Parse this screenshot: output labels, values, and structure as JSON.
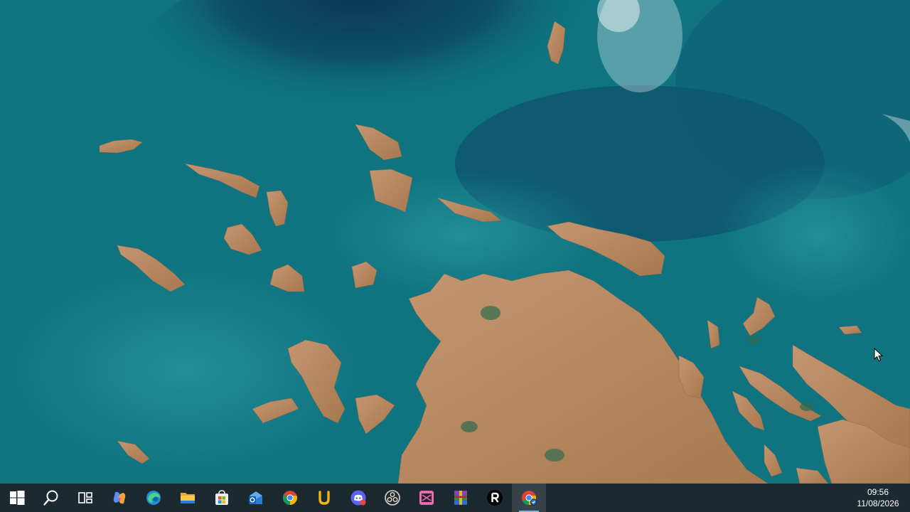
{
  "taskbar": {
    "apps": [
      {
        "name": "Start",
        "icon": "windows-logo-icon"
      },
      {
        "name": "Search",
        "icon": "search-icon"
      },
      {
        "name": "Task View",
        "icon": "task-view-icon"
      },
      {
        "name": "Copilot",
        "icon": "copilot-icon"
      },
      {
        "name": "Microsoft Edge",
        "icon": "edge-icon"
      },
      {
        "name": "File Explorer",
        "icon": "folder-icon"
      },
      {
        "name": "Microsoft Store",
        "icon": "store-icon"
      },
      {
        "name": "Outlook",
        "icon": "outlook-icon"
      },
      {
        "name": "Google Chrome",
        "icon": "chrome-icon"
      },
      {
        "name": "U app",
        "icon": "u-app-icon"
      },
      {
        "name": "Discord",
        "icon": "discord-icon"
      },
      {
        "name": "OBS",
        "icon": "obs-icon"
      },
      {
        "name": "Film app",
        "icon": "film-app-icon"
      },
      {
        "name": "WinRAR",
        "icon": "winrar-icon"
      },
      {
        "name": "R app",
        "icon": "r-app-icon"
      },
      {
        "name": "Chrome Canary",
        "icon": "chrome-canary-icon"
      }
    ],
    "accent": "#76b9ed"
  },
  "tray": {
    "time": "09:56",
    "date": "11/08/2026"
  },
  "colors": {
    "sea": "#0e6f7a",
    "deep_sea": "#0b3d5a",
    "land": "#b88a64",
    "taskbar": "#1c2a30"
  }
}
